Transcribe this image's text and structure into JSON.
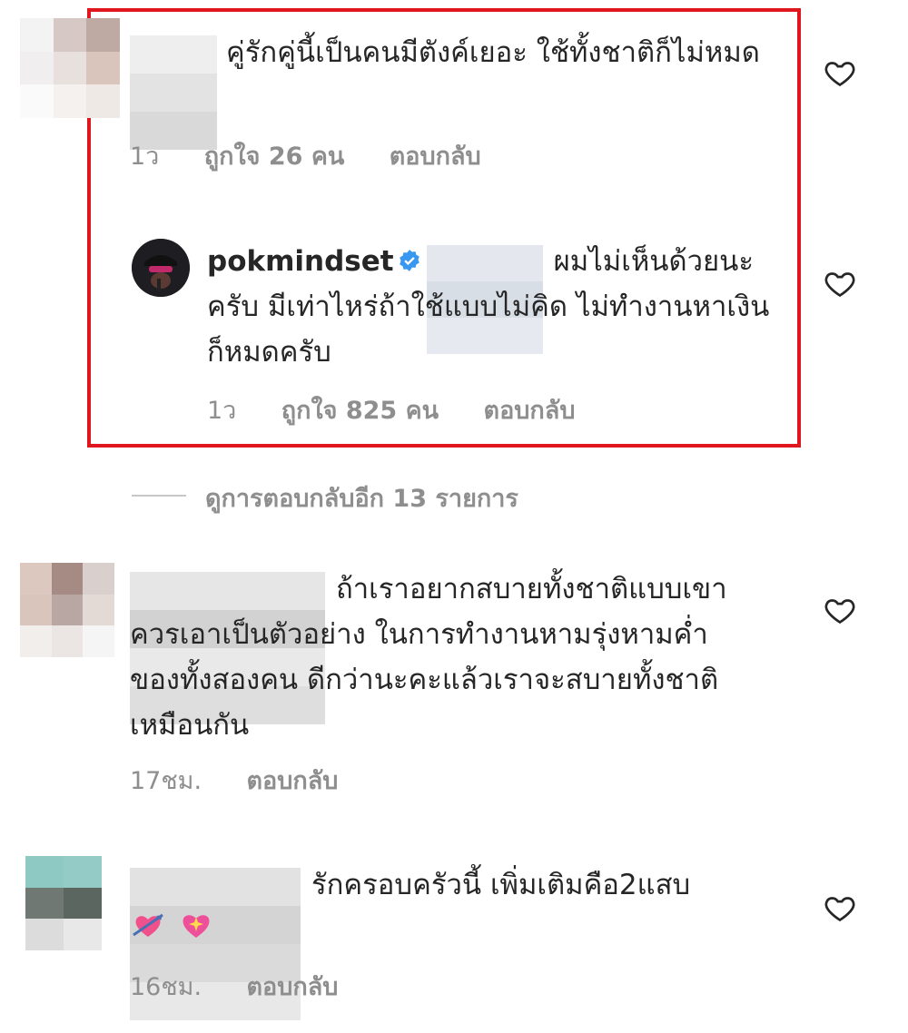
{
  "comments": [
    {
      "text": "คู่รักคู่นี้เป็นคนมีตังค์เยอะ ใช้ทั้งชาติก็ไม่หมด",
      "time": "1ว",
      "likes": "ถูกใจ 26 คน",
      "reply_label": "ตอบกลับ"
    },
    {
      "username": "pokmindset",
      "text": "ผมไม่เห็นด้วยนะครับ มีเท่าไหร่ถ้าใช้แบบไม่คิด ไม่ทำงานหาเงิน ก็หมดครับ",
      "time": "1ว",
      "likes": "ถูกใจ 825 คน",
      "reply_label": "ตอบกลับ"
    },
    {
      "text": "ถ้าเราอยากสบายทั้งชาติแบบเขาควรเอาเป็นตัวอย่าง ในการทำงานหามรุ่งหามค่ำของทั้งสองคน ดีกว่านะคะแล้วเราจะสบายทั้งชาติเหมือนกัน",
      "time": "17ชม.",
      "reply_label": "ตอบกลับ"
    },
    {
      "text": "รักครอบครัวนี้ เพิ่มเติมคือ2แสบ",
      "emojis": [
        "heart-with-arrow-emoji",
        "sparkling-heart-emoji"
      ],
      "time": "16ชม.",
      "reply_label": "ตอบกลับ"
    }
  ],
  "view_replies": "ดูการตอบกลับอีก 13 รายการ",
  "colors": {
    "highlight": "#e0161f",
    "verified": "#3897f0",
    "meta": "#8e8e8e"
  },
  "icons": [
    "heart-outline-icon",
    "verified-badge-icon"
  ]
}
